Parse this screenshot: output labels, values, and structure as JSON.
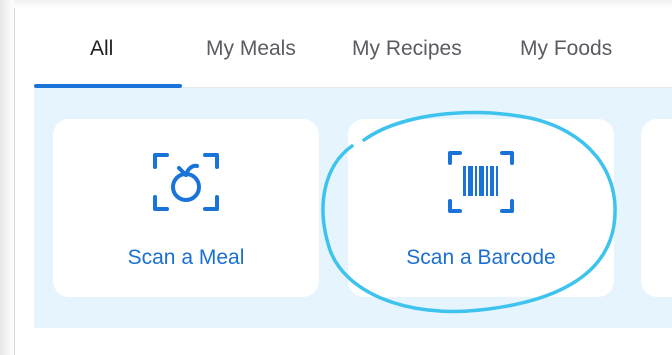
{
  "tabs": [
    {
      "label": "All",
      "active": true
    },
    {
      "label": "My Meals",
      "active": false
    },
    {
      "label": "My Recipes",
      "active": false
    },
    {
      "label": "My Foods",
      "active": false
    }
  ],
  "cards": [
    {
      "label": "Scan a Meal",
      "icon": "scan-meal-icon"
    },
    {
      "label": "Scan a Barcode",
      "icon": "barcode-scan-icon"
    }
  ],
  "colors": {
    "accent": "#1a73d9",
    "label_blue": "#1a6fd1",
    "panel_background": "#e6f4fd",
    "annotation_circle": "#3ec3ee"
  }
}
